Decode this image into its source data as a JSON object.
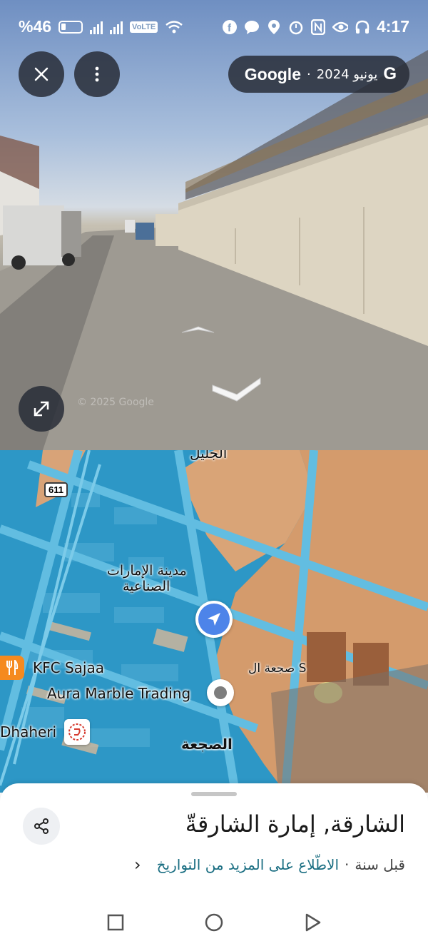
{
  "status_bar": {
    "battery_percent": "%46",
    "network": "VoLTE",
    "time": "4:17"
  },
  "street_view": {
    "brand": "Google",
    "capture_date": "يونيو 2024",
    "separator": "·",
    "g_mark": "G",
    "watermark": "© 2025 Google"
  },
  "map": {
    "road_number": "611",
    "labels": {
      "top_area": "الجليل",
      "industrial_city_line1": "مدينة الإمارات",
      "industrial_city_line2": "الصناعية",
      "kfc": "KFC Sajaa",
      "sajaa_s": "صجعة ال S",
      "aura": "Aura Marble Trading",
      "dhaheri": "Dhaheri",
      "sajaa": "الصجعة"
    }
  },
  "sheet": {
    "place_title": "الشارقة, إمارة الشارقةّ",
    "date_ago": "قبل سنة",
    "separator": "·",
    "more_dates_link": "الاطّلاع على المزيد من التواريخ"
  },
  "colors": {
    "map_water_overlay": "#2d97c6",
    "desert": "#d49b6c",
    "accent_blue": "#4d84e9",
    "link_teal": "#1a6e82",
    "food_orange": "#f58a1f"
  }
}
